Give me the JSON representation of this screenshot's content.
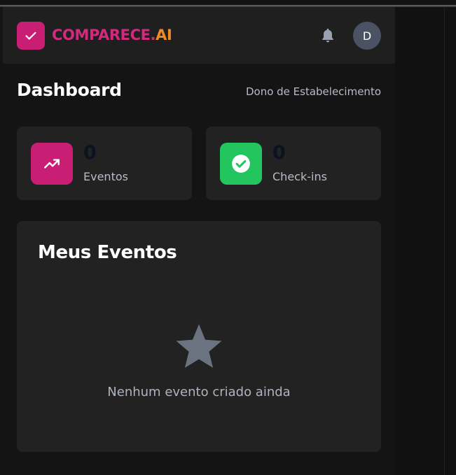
{
  "header": {
    "logo_main": "COMPARECE.",
    "logo_accent": "AI",
    "avatar_initial": "D",
    "logo_color": "#c81f74",
    "accent_color": "#f08a25"
  },
  "page": {
    "title": "Dashboard",
    "role": "Dono de Estabelecimento"
  },
  "stats": [
    {
      "value": "0",
      "label": "Eventos",
      "icon": "trending-up-icon",
      "color": "#c81f74"
    },
    {
      "value": "0",
      "label": "Check-ins",
      "icon": "check-circle-icon",
      "color": "#22c55e"
    }
  ],
  "events": {
    "title": "Meus Eventos",
    "empty_message": "Nenhum evento criado ainda",
    "empty_icon": "star-icon"
  }
}
